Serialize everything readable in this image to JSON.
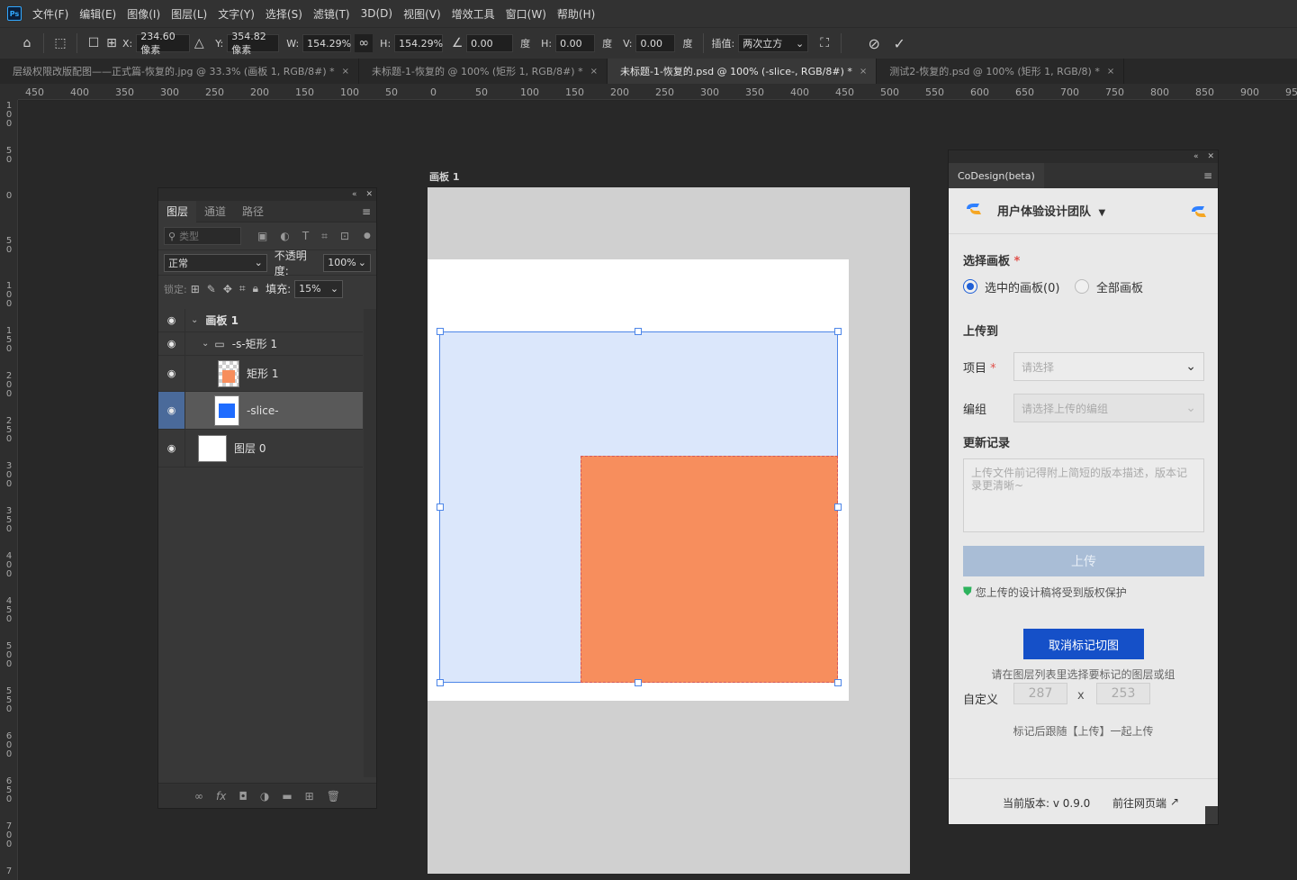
{
  "app": {
    "logo": "Ps"
  },
  "menu": [
    "文件(F)",
    "编辑(E)",
    "图像(I)",
    "图层(L)",
    "文字(Y)",
    "选择(S)",
    "滤镜(T)",
    "3D(D)",
    "视图(V)",
    "增效工具",
    "窗口(W)",
    "帮助(H)"
  ],
  "options": {
    "x_label": "X:",
    "x_value": "234.60 像素",
    "y_label": "Y:",
    "y_value": "354.82 像素",
    "w_label": "W:",
    "w_value": "154.29%",
    "h_label": "H:",
    "h_value": "154.29%",
    "angle_value": "0.00",
    "angle_unit": "度",
    "hskew_label": "H:",
    "hskew_value": "0.00",
    "hskew_unit": "度",
    "vskew_label": "V:",
    "vskew_value": "0.00",
    "vskew_unit": "度",
    "interp_label": "插值:",
    "interp_value": "两次立方"
  },
  "tabs": [
    {
      "label": "层级权限改版配图——正式篇-恢复的.jpg @ 33.3% (画板 1, RGB/8#) *",
      "close": "×"
    },
    {
      "label": "未标题-1-恢复的 @ 100% (矩形 1, RGB/8#) *",
      "close": "×"
    },
    {
      "label": "未标题-1-恢复的.psd @ 100% (-slice-, RGB/8#) *",
      "close": "×"
    },
    {
      "label": "测试2-恢复的.psd @ 100% (矩形 1, RGB/8) *",
      "close": "×"
    }
  ],
  "ruler_h": [
    "450",
    "400",
    "350",
    "300",
    "250",
    "200",
    "150",
    "100",
    "50",
    "0",
    "50",
    "100",
    "150",
    "200",
    "250",
    "300",
    "350",
    "400",
    "450",
    "500",
    "550",
    "600",
    "650",
    "700",
    "750",
    "800",
    "850",
    "900",
    "95"
  ],
  "ruler_v": [
    "100",
    "50",
    "0",
    "50",
    "100",
    "150",
    "200",
    "250",
    "300",
    "350",
    "400",
    "450",
    "500",
    "550",
    "600",
    "650",
    "700",
    "7"
  ],
  "artboard": {
    "label": "画板 1"
  },
  "layers_panel": {
    "tabs": [
      "图层",
      "通道",
      "路径"
    ],
    "filter_placeholder": "类型",
    "blend_mode": "正常",
    "opacity_label": "不透明度:",
    "opacity_value": "100%",
    "lock_label": "锁定:",
    "fill_label": "填充:",
    "fill_value": "15%",
    "layers": [
      {
        "name": "画板 1"
      },
      {
        "name": "-s-矩形 1"
      },
      {
        "name": "矩形 1"
      },
      {
        "name": "-slice-"
      },
      {
        "name": "图层 0"
      }
    ]
  },
  "codesign": {
    "tab": "CoDesign(beta)",
    "team": "用户体验设计团队",
    "select_artboard_label": "选择画板",
    "radio_selected": "选中的画板(0)",
    "radio_all": "全部画板",
    "upload_to_label": "上传到",
    "project_label": "项目",
    "project_placeholder": "请选择",
    "group_label": "编组",
    "group_placeholder": "请选择上传的编组",
    "changelog_label": "更新记录",
    "changelog_placeholder": "上传文件前记得附上简短的版本描述，版本记录更清晰~",
    "upload_button": "上传",
    "copyright_note": "您上传的设计稿将受到版权保护",
    "unmark_button": "取消标记切图",
    "hint": "请在图层列表里选择要标记的图层或组",
    "custom_label": "自定义",
    "custom_w": "287",
    "custom_x": "x",
    "custom_h": "253",
    "after_mark": "标记后跟随【上传】一起上传",
    "version": "当前版本: v 0.9.0",
    "web_link": "前往网页端"
  },
  "colors": {
    "accent": "#1f5fd6",
    "orange": "#f78e5d",
    "selection_blue": "#dbe7fb"
  }
}
